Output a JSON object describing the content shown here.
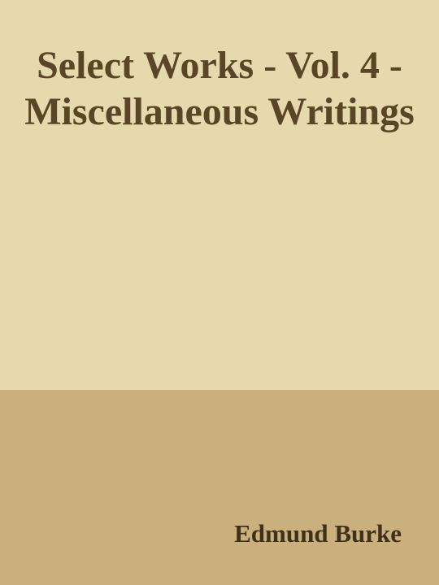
{
  "cover": {
    "title": "Select Works - Vol. 4 - Miscellaneous Writings",
    "author": "Edmund Burke"
  },
  "colors": {
    "top_background": "#e6d9ad",
    "bottom_background": "#c9b07d",
    "text": "#5a4627",
    "author_text": "#3f3019"
  }
}
